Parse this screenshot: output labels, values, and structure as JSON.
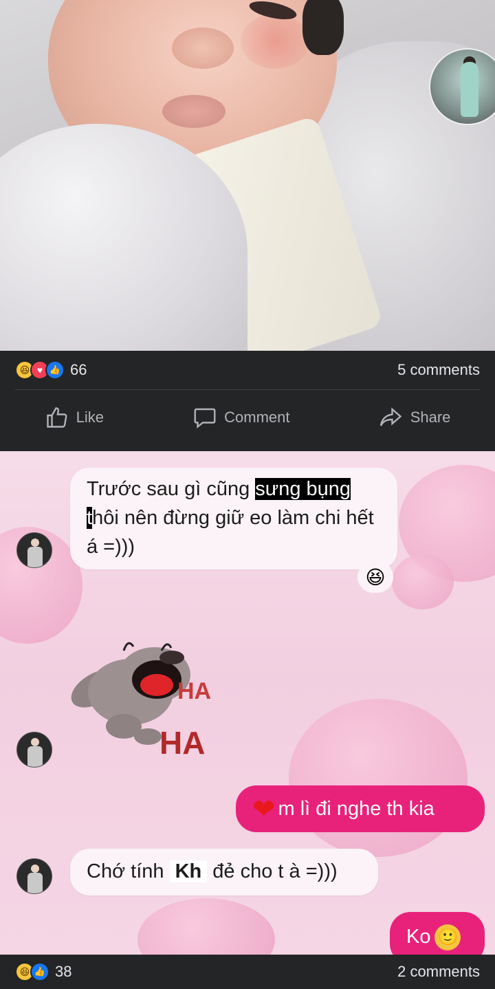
{
  "post1": {
    "reaction_icons": [
      "haha-icon",
      "love-icon",
      "like-icon"
    ],
    "reaction_count": "66",
    "comments_label": "5 comments",
    "actions": {
      "like": "Like",
      "comment": "Comment",
      "share": "Share"
    }
  },
  "chat": {
    "msg1": {
      "before": "Trước sau gì cũng ",
      "highlight": "sưng bụng",
      "highlight_t": "t",
      "after": "hôi nên đừng giữ eo làm chi hết á =)))"
    },
    "msg1_reaction": "😆",
    "sticker": {
      "text_top": "HA",
      "text_bottom": "HA"
    },
    "msg_out1": {
      "emoji": "❤",
      "text": "m lì đi nghe th kia"
    },
    "msg2": {
      "before": "Chớ tính ",
      "bold": "Kh",
      "after": " đẻ cho t à =)))"
    },
    "msg_out2": {
      "text": "Ko",
      "emoji": "🙂"
    }
  },
  "post2": {
    "reaction_icons": [
      "haha-icon",
      "like-icon"
    ],
    "reaction_count": "38",
    "comments_label": "2 comments"
  },
  "colors": {
    "bar_bg": "#242526",
    "text": "#e4e6eb",
    "muted": "#b0b3b8",
    "outgoing_bubble": "#e8227a",
    "chat_bg": "#f6dce8"
  }
}
